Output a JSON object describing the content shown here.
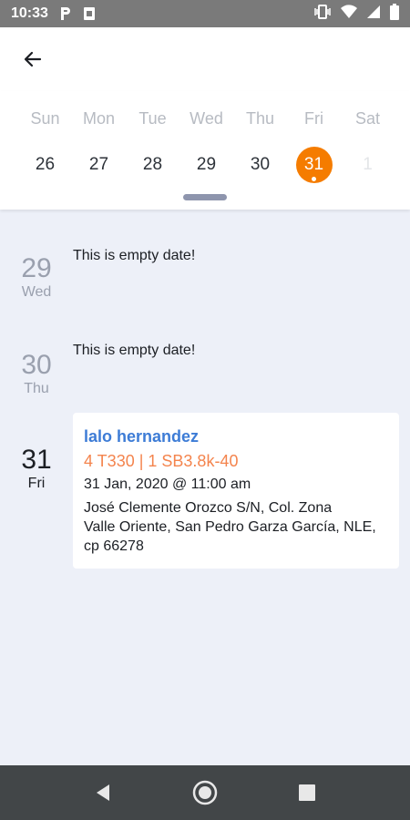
{
  "status_bar": {
    "time": "10:33",
    "left_icons": [
      "parking-icon",
      "sim-card-icon"
    ],
    "right_icons": [
      "vibrate-icon",
      "wifi-icon",
      "signal-icon",
      "battery-icon"
    ]
  },
  "app_bar": {
    "back_icon": "arrow-left-icon"
  },
  "week": {
    "day_names": [
      "Sun",
      "Mon",
      "Tue",
      "Wed",
      "Thu",
      "Fri",
      "Sat"
    ],
    "days": [
      {
        "num": "26",
        "state": "normal"
      },
      {
        "num": "27",
        "state": "normal"
      },
      {
        "num": "28",
        "state": "normal"
      },
      {
        "num": "29",
        "state": "normal"
      },
      {
        "num": "30",
        "state": "normal"
      },
      {
        "num": "31",
        "state": "selected"
      },
      {
        "num": "1",
        "state": "disabled"
      }
    ],
    "accent_color": "#f57c00"
  },
  "agenda": {
    "rows": [
      {
        "date_num": "29",
        "day_name": "Wed",
        "empty_text": "This is empty date!"
      },
      {
        "date_num": "30",
        "day_name": "Thu",
        "empty_text": "This is empty date!"
      },
      {
        "date_num": "31",
        "day_name": "Fri",
        "event": {
          "name": "lalo hernandez",
          "items": "4 T330 | 1 SB3.8k-40",
          "datetime": "31 Jan, 2020 @ 11:00 am",
          "address_lines": [
            "José Clemente Orozco S/N, Col. Zona",
            "Valle Oriente, San Pedro Garza García, NLE,",
            "cp 66278"
          ]
        }
      }
    ]
  },
  "nav_bar": {
    "icons": [
      "back-triangle-icon",
      "home-circle-icon",
      "recents-square-icon"
    ]
  }
}
